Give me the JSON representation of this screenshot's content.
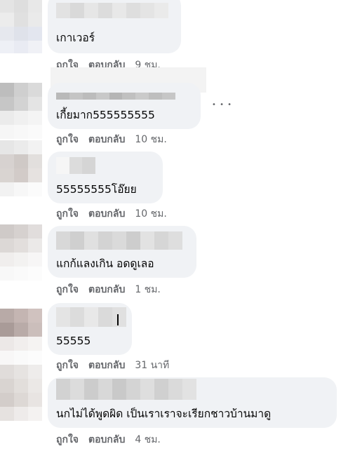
{
  "labels": {
    "like": "ถูกใจ",
    "reply": "ตอบกลับ"
  },
  "more_icon_glyph": "• • •",
  "comments": [
    {
      "text": "เกาเวอร์",
      "time": "9 ชม."
    },
    {
      "text": "เกี้ยมาก555555555",
      "time": "10 ชม."
    },
    {
      "text": "55555555โอ๊ยย",
      "time": "10 ชม."
    },
    {
      "text": "แกก้แลงเกิน อดดูเลอ",
      "time": "1 ชม."
    },
    {
      "text": "55555",
      "time": "31 นาที"
    },
    {
      "text": "นกไม่ได้พูดผิด เป็นเราเราจะเรียกชาวบ้านมาดู",
      "time": "4 ชม."
    }
  ],
  "colors": {
    "bubble": "#f0f2f5",
    "meta_text": "#65676b",
    "body_text": "#050505"
  }
}
